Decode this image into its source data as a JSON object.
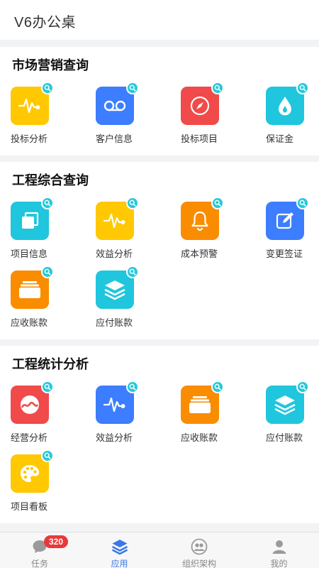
{
  "header": {
    "title": "V6办公桌"
  },
  "colors": {
    "yellow": "#ffc800",
    "blue": "#3d7dff",
    "red": "#f04a4a",
    "cyan": "#1fc6dd",
    "orange": "#fa8c00",
    "badge": "#26c9d9",
    "tab_active": "#3a78e8",
    "count_badge": "#e8393a"
  },
  "sections": [
    {
      "title": "市场营销查询",
      "items": [
        {
          "label": "投标分析",
          "icon": "pulse-icon",
          "color": "#ffc800"
        },
        {
          "label": "客户信息",
          "icon": "voicemail-icon",
          "color": "#3d7dff"
        },
        {
          "label": "投标项目",
          "icon": "compass-icon",
          "color": "#f04a4a"
        },
        {
          "label": "保证金",
          "icon": "droplet-icon",
          "color": "#1fc6dd"
        }
      ]
    },
    {
      "title": "工程综合查询",
      "items": [
        {
          "label": "项目信息",
          "icon": "copy-icon",
          "color": "#1fc6dd"
        },
        {
          "label": "效益分析",
          "icon": "pulse-icon",
          "color": "#ffc800"
        },
        {
          "label": "成本预警",
          "icon": "bell-icon",
          "color": "#fa8c00"
        },
        {
          "label": "变更签证",
          "icon": "edit-icon",
          "color": "#3d7dff"
        },
        {
          "label": "应收账款",
          "icon": "folder-icon",
          "color": "#fa8c00"
        },
        {
          "label": "应付账款",
          "icon": "layers-icon",
          "color": "#1fc6dd"
        }
      ]
    },
    {
      "title": "工程统计分析",
      "items": [
        {
          "label": "经营分析",
          "icon": "gauge-icon",
          "color": "#f04a4a"
        },
        {
          "label": "效益分析",
          "icon": "pulse-icon",
          "color": "#3d7dff"
        },
        {
          "label": "应收账款",
          "icon": "folder-icon",
          "color": "#fa8c00"
        },
        {
          "label": "应付账款",
          "icon": "layers-icon",
          "color": "#1fc6dd"
        },
        {
          "label": "项目看板",
          "icon": "palette-icon",
          "color": "#ffc800"
        }
      ]
    }
  ],
  "tabbar": [
    {
      "label": "任务",
      "icon": "chat-bubble-icon",
      "badge": "320",
      "active": false
    },
    {
      "label": "应用",
      "icon": "layers-icon",
      "active": true
    },
    {
      "label": "组织架构",
      "icon": "people-icon",
      "active": false
    },
    {
      "label": "我的",
      "icon": "person-icon",
      "active": false
    }
  ]
}
